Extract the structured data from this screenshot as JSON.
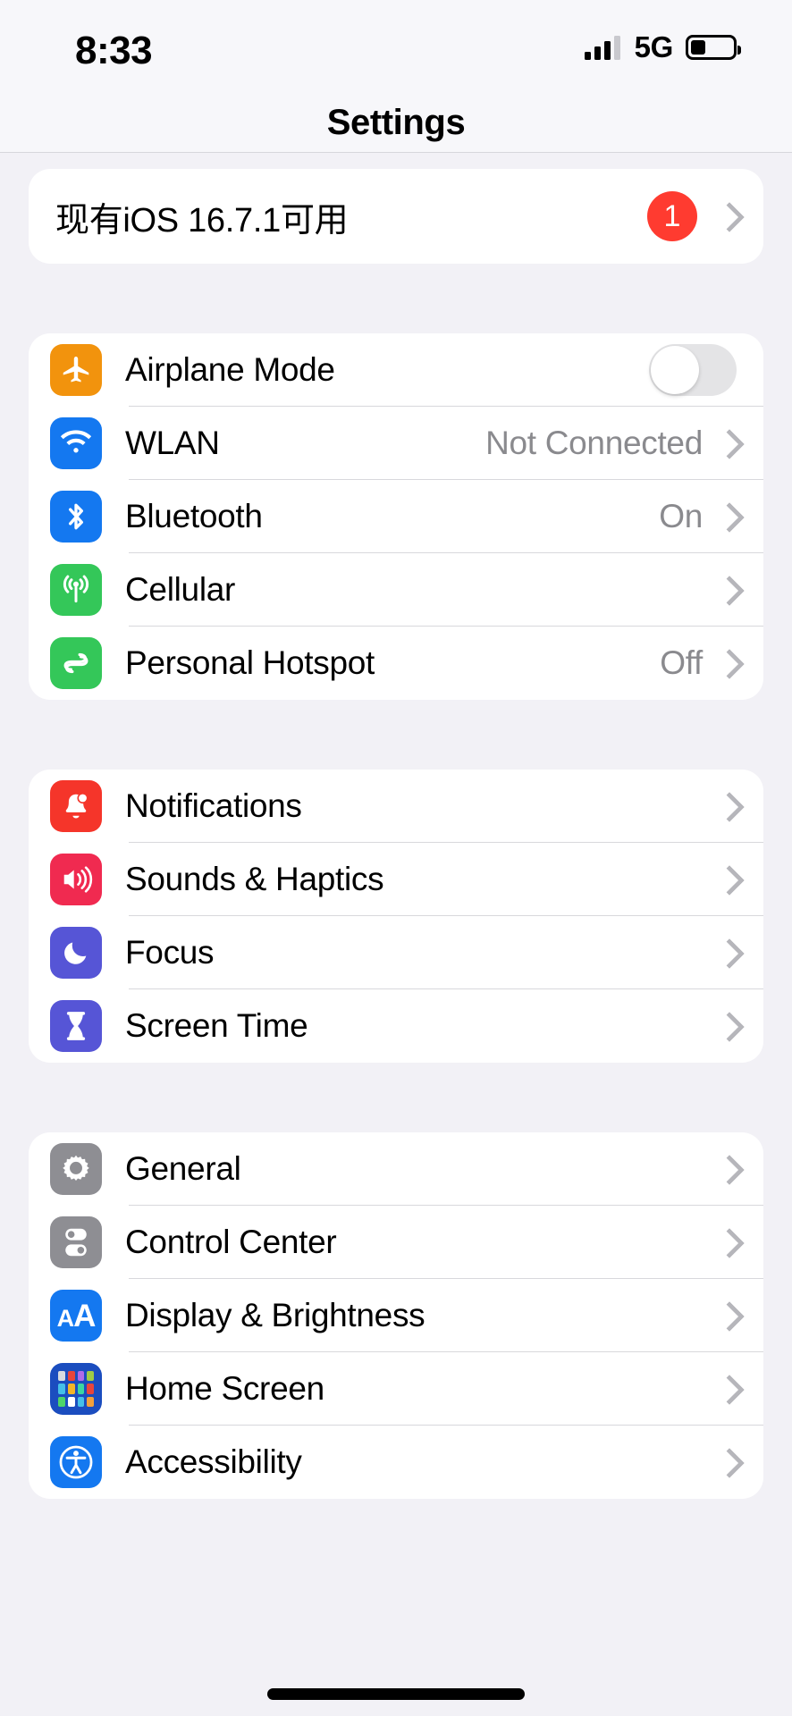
{
  "status_bar": {
    "time": "8:33",
    "network_label": "5G",
    "signal_bars_filled": 3,
    "signal_bars_total": 4,
    "battery_percent": 36,
    "icons": [
      "cellular-signal-icon",
      "battery-icon"
    ]
  },
  "header": {
    "title": "Settings"
  },
  "update_banner": {
    "label": "现有iOS 16.7.1可用",
    "badge": "1",
    "badge_color": "#FF3B30",
    "accessory": "chevron-right-icon"
  },
  "groups": [
    {
      "name": "connectivity",
      "rows": [
        {
          "label": "Airplane Mode",
          "icon": "airplane-icon",
          "icon_color": "#F2930D",
          "accessory": "toggle",
          "toggle_on": false,
          "value": ""
        },
        {
          "label": "WLAN",
          "icon": "wifi-icon",
          "icon_color": "#1478F0",
          "accessory": "chevron",
          "value": "Not Connected"
        },
        {
          "label": "Bluetooth",
          "icon": "bluetooth-icon",
          "icon_color": "#1478F0",
          "accessory": "chevron",
          "value": "On"
        },
        {
          "label": "Cellular",
          "icon": "cellular-antenna-icon",
          "icon_color": "#34C759",
          "accessory": "chevron",
          "value": ""
        },
        {
          "label": "Personal Hotspot",
          "icon": "hotspot-link-icon",
          "icon_color": "#34C759",
          "accessory": "chevron",
          "value": "Off"
        }
      ]
    },
    {
      "name": "alerts",
      "rows": [
        {
          "label": "Notifications",
          "icon": "bell-icon",
          "icon_color": "#F5352A",
          "accessory": "chevron",
          "value": ""
        },
        {
          "label": "Sounds & Haptics",
          "icon": "speaker-icon",
          "icon_color": "#F02A50",
          "accessory": "chevron",
          "value": ""
        },
        {
          "label": "Focus",
          "icon": "moon-icon",
          "icon_color": "#5655D6",
          "accessory": "chevron",
          "value": ""
        },
        {
          "label": "Screen Time",
          "icon": "hourglass-icon",
          "icon_color": "#5655D6",
          "accessory": "chevron",
          "value": ""
        }
      ]
    },
    {
      "name": "system",
      "rows": [
        {
          "label": "General",
          "icon": "gear-icon",
          "icon_color": "#8E8E93",
          "accessory": "chevron",
          "value": ""
        },
        {
          "label": "Control Center",
          "icon": "control-center-icon",
          "icon_color": "#8E8E93",
          "accessory": "chevron",
          "value": ""
        },
        {
          "label": "Display & Brightness",
          "icon": "display-aa-icon",
          "icon_color": "#1478F0",
          "accessory": "chevron",
          "value": ""
        },
        {
          "label": "Home Screen",
          "icon": "home-screen-grid-icon",
          "icon_color": "#1B4DBF",
          "accessory": "chevron",
          "value": ""
        },
        {
          "label": "Accessibility",
          "icon": "accessibility-icon",
          "icon_color": "#1478F0",
          "accessory": "chevron",
          "value": ""
        }
      ]
    }
  ],
  "home_indicator": "home-indicator-bar"
}
